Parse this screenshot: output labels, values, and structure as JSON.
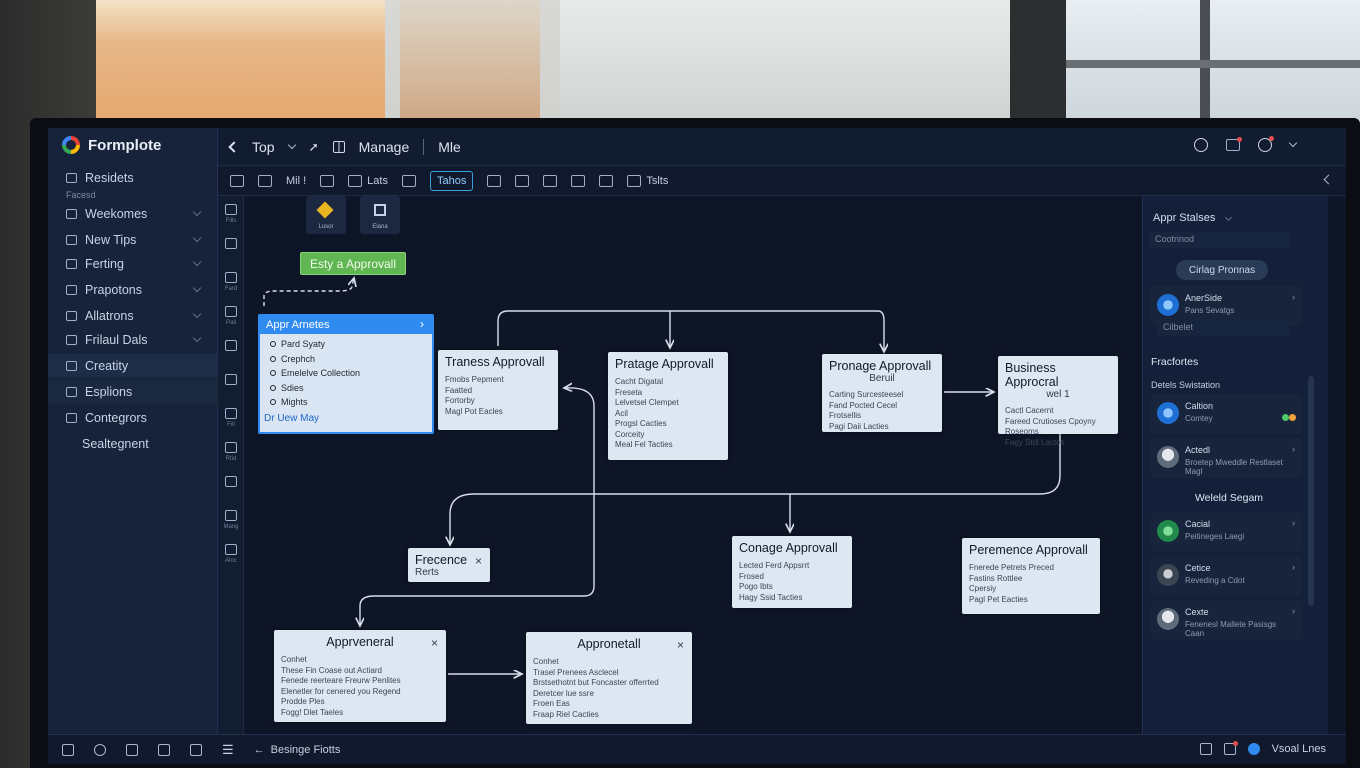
{
  "app": {
    "title": "Formplote"
  },
  "sidebar": {
    "items": [
      {
        "label": "Residets",
        "icon": "back-arrow-icon",
        "chevron": false
      },
      {
        "label": "Facesd",
        "small": true
      },
      {
        "label": "Weekomes",
        "icon": "folder-icon",
        "chevron": true
      },
      {
        "label": "New Tips",
        "icon": "tag-icon",
        "chevron": true
      },
      {
        "label": "Ferting",
        "icon": "gear-icon",
        "chevron": true
      },
      {
        "label": "Prapotons",
        "icon": "doc-icon",
        "chevron": true
      },
      {
        "label": "Allatrons",
        "icon": "list-icon",
        "chevron": true
      },
      {
        "label": "Frilaul Dals",
        "icon": "table-icon",
        "chevron": true
      },
      {
        "label": "Creatity",
        "icon": "chat-icon",
        "chevron": false
      },
      {
        "label": "Esplions",
        "icon": "card-icon",
        "chevron": false
      },
      {
        "label": "Contegrors",
        "icon": "nodes-icon",
        "chevron": false
      },
      {
        "label": "Sealtegnent",
        "icon": "",
        "chevron": false
      }
    ]
  },
  "topbar": {
    "crumb1": "Top",
    "crumb2": "Manage",
    "crumb3": "Mle"
  },
  "toolbar": {
    "items": [
      {
        "label": "",
        "icon": "home-icon"
      },
      {
        "label": "",
        "icon": "user-icon"
      },
      {
        "label": "Mil !",
        "icon": ""
      },
      {
        "label": "",
        "icon": "globe-icon"
      },
      {
        "label": "Lats",
        "icon": "tag-icon"
      },
      {
        "label": "",
        "icon": "checkbox-icon"
      },
      {
        "label": "Tahos",
        "icon": "",
        "active": true
      },
      {
        "label": "",
        "icon": "table-icon"
      },
      {
        "label": "",
        "icon": "book-icon"
      },
      {
        "label": "",
        "icon": "chart-icon"
      },
      {
        "label": "",
        "icon": "image-icon"
      },
      {
        "label": "",
        "icon": "search-icon"
      },
      {
        "label": "Tslts",
        "icon": "gift-icon"
      }
    ]
  },
  "toolstrip": {
    "labels": [
      "Fills",
      "",
      "Fard",
      "Pali",
      "",
      "",
      "Fill",
      "Rtid",
      "",
      "Mang",
      "Aloc"
    ]
  },
  "canvas": {
    "chip1": "Lusor",
    "chip2": "Elana",
    "start": "Esty a Approvall",
    "menu": {
      "header": "Appr Arnetes",
      "options": [
        "Pard Syaty",
        "Crephch",
        "Emelelve Collection",
        "Sdies",
        "Mights"
      ],
      "footer": "Dr Uew May"
    },
    "cards": [
      {
        "title": "Traness Approvall",
        "lines": [
          "Fmobs Pepment",
          "Faatted",
          "Fortorby",
          "Magl Pot Eacles"
        ]
      },
      {
        "title": "Pratage Approvall",
        "lines": [
          "Cacht Digatal",
          "Freseta",
          "Lelvetsel Clempet",
          "Acil",
          "Progsl Cacties",
          "Corceity",
          "Meal Fel Tacties"
        ]
      },
      {
        "title": "Pronage Approvall",
        "subtitle": "Beruil",
        "lines": [
          "Carting Surcesteesel",
          "Fand Pocted Cecel",
          "Frotsellis",
          "Pagi Daii Lacties"
        ]
      },
      {
        "title": "Business Approcral",
        "subtitle": "wel 1",
        "lines": [
          "Cactl Cacernt",
          "Fareed Crutioses Cpoyny",
          "Roseoms",
          "Fagy Stdi Lactes"
        ]
      },
      {
        "title": "Frecence",
        "subtitle": "Rerts",
        "lines": []
      },
      {
        "title": "Conage Approvall",
        "lines": [
          "Lected Ferd Appsrrt",
          "Frosed",
          "Pogo Ibts",
          "Hagy Ssid Tacties"
        ]
      },
      {
        "title": "Peremence Approvall",
        "lines": [
          "Fnerede Petrets Preced",
          "Fastins Rottlee",
          "Cpersiy",
          "Pagl Pet Eacties"
        ]
      },
      {
        "title": "Apprveneral",
        "lines": [
          "Conhet",
          "These Fin Coase out Actiard",
          "Fenede reerteare Freurw Penlites",
          "Elenetler for cenered you Regend",
          "Prodde Ples",
          "Fogg! Dlet Taeles"
        ]
      },
      {
        "title": "Appronetall",
        "lines": [
          "Conhet",
          "Trasel Prenees Asclecel",
          "Brstsethotnt but Foncaster offerrted",
          "Deretcer lue ssre",
          "Froen Eas",
          "Fraap Riel Cacties"
        ]
      }
    ]
  },
  "right_panel": {
    "section1": "Appr Stalses",
    "dropdown": "Cootrinod",
    "button": "Cirlag Pronnas",
    "person1": {
      "name": "AnerSide",
      "sub": "Pans Sevatgs"
    },
    "dropdown2": "Cilbelet",
    "section2": "Fracfortes",
    "group1": "Detels Swistation",
    "person2": {
      "name": "Caltion",
      "sub": "Comtey"
    },
    "person3": {
      "name": "Actedl",
      "sub": "Broetep Mweddle Restlaset Magl"
    },
    "section3": "Weleld Segam",
    "person4": {
      "name": "Cacial",
      "sub": "Peitineges Laegi"
    },
    "person5": {
      "name": "Cetice",
      "sub": "Reveding a Cdot"
    },
    "person6": {
      "name": "Cexte",
      "sub": "Fenenesl Mallete Pasisgs Caan"
    }
  },
  "statusbar": {
    "label": "Besinge Fiotts",
    "right_label": "Vsoal Lnes"
  },
  "colors": {
    "accent": "#2f8bf0",
    "start_green": "#5fb653",
    "card_bg": "#dce7f2",
    "screen_bg": "#0f1628"
  }
}
